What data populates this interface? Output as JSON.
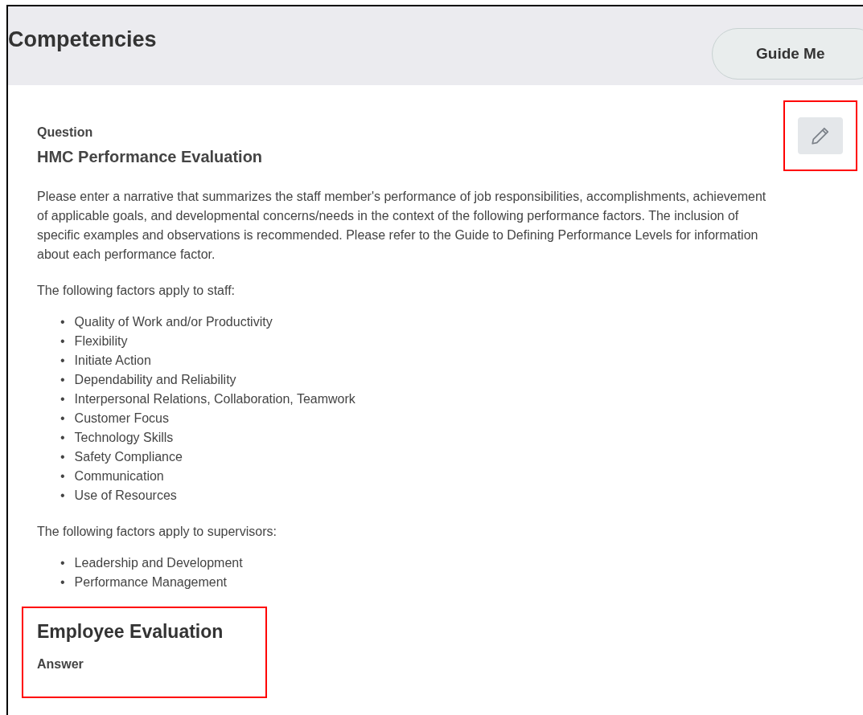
{
  "header": {
    "title": "Competencies",
    "guide_button": "Guide Me"
  },
  "question": {
    "label": "Question",
    "title": "HMC Performance Evaluation",
    "edit_button": {
      "highlighted": true
    }
  },
  "narrative": "Please enter a narrative that summarizes the staff member's performance of job responsibilities, accomplishments, achievement of applicable goals, and developmental concerns/needs in the context of the following performance factors. The inclusion of specific examples and observations is recommended. Please refer to the Guide to Defining Performance Levels for information about each performance factor.",
  "groups": [
    {
      "intro": "The following factors apply to staff:",
      "marker": "•",
      "items": [
        "Quality of Work and/or Productivity",
        "Flexibility",
        "Initiate Action",
        "Dependability and Reliability",
        "Interpersonal Relations, Collaboration, Teamwork",
        "Customer Focus",
        "Technology Skills",
        "Safety Compliance",
        "Communication",
        "Use of Resources"
      ]
    },
    {
      "intro": "The following factors apply to supervisors:",
      "marker": "•",
      "items": [
        "Leadership and Development",
        "Performance Management"
      ]
    }
  ],
  "answer_section": {
    "title": "Employee Evaluation",
    "label": "Answer",
    "highlighted": true
  }
}
